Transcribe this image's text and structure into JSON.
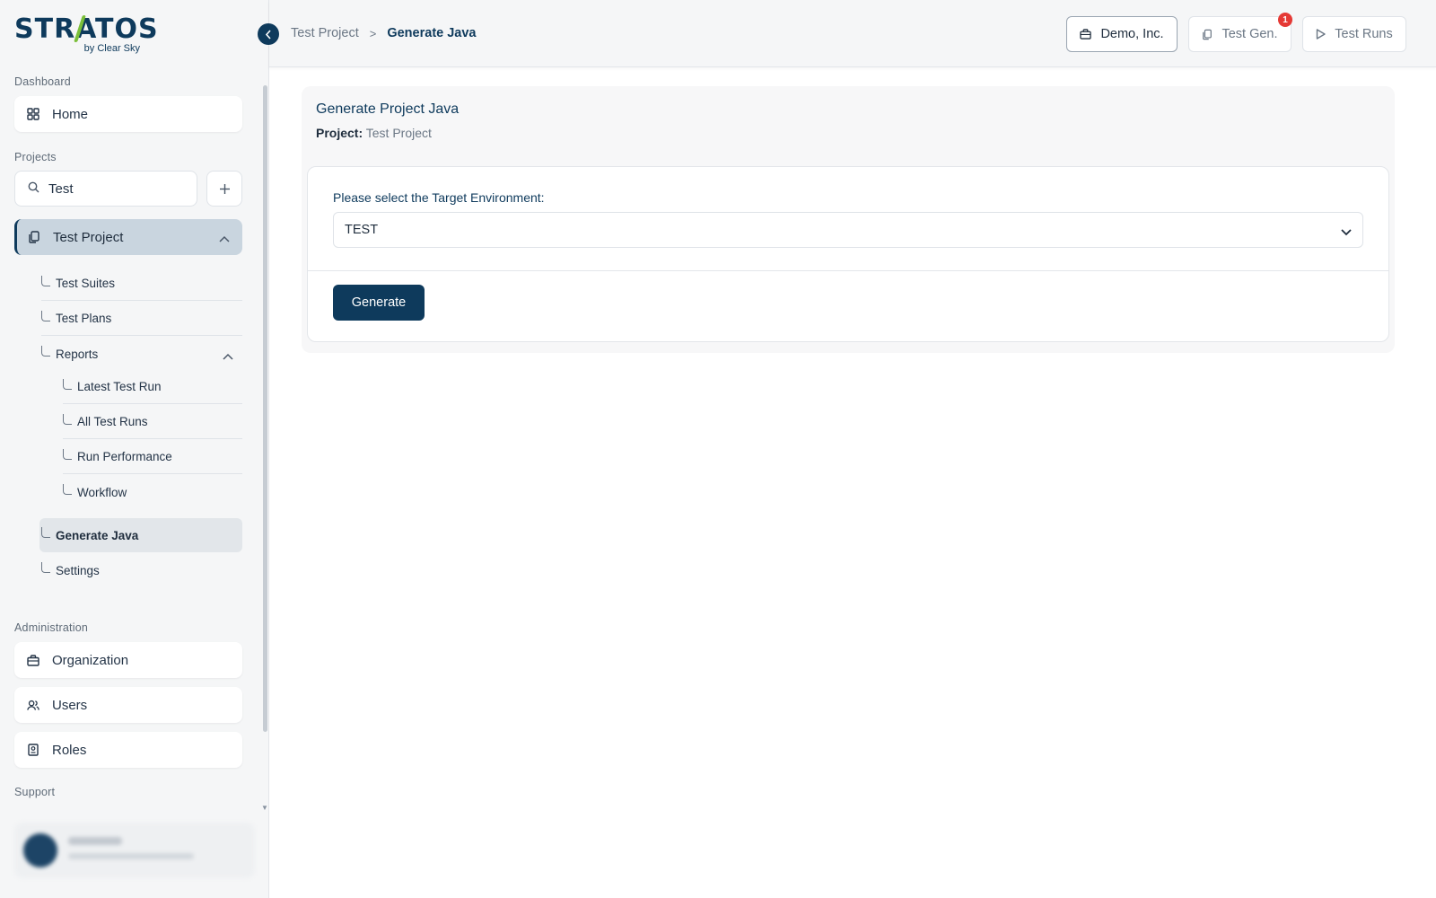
{
  "brand": {
    "name": "STRATOS",
    "tagline": "by Clear Sky"
  },
  "sidebar": {
    "dashboard_label": "Dashboard",
    "home_label": "Home",
    "projects_label": "Projects",
    "search_value": "Test",
    "project": {
      "name": "Test Project",
      "children": [
        {
          "label": "Test Suites"
        },
        {
          "label": "Test Plans"
        },
        {
          "label": "Reports"
        },
        {
          "label": "Latest Test Run"
        },
        {
          "label": "All Test Runs"
        },
        {
          "label": "Run Performance"
        },
        {
          "label": "Workflow"
        },
        {
          "label": "Generate Java"
        },
        {
          "label": "Settings"
        }
      ]
    },
    "administration_label": "Administration",
    "admin_items": [
      {
        "label": "Organization",
        "icon": "briefcase-icon"
      },
      {
        "label": "Users",
        "icon": "users-icon"
      },
      {
        "label": "Roles",
        "icon": "id-badge-icon"
      }
    ],
    "support_label": "Support"
  },
  "topbar": {
    "breadcrumb": {
      "parent": "Test Project",
      "separator": ">",
      "current": "Generate Java"
    },
    "org_button": "Demo, Inc.",
    "testgen_button": "Test Gen.",
    "testgen_badge": "1",
    "testruns_button": "Test Runs"
  },
  "main": {
    "title": "Generate Project Java",
    "project_label": "Project:",
    "project_value": "Test Project",
    "env_label": "Please select the Target Environment:",
    "env_value": "TEST",
    "generate_button": "Generate"
  },
  "colors": {
    "primary": "#0e3a5c",
    "accent": "#7bbf3a",
    "badge": "#e53935",
    "active_project_bg": "#c9d5df"
  }
}
